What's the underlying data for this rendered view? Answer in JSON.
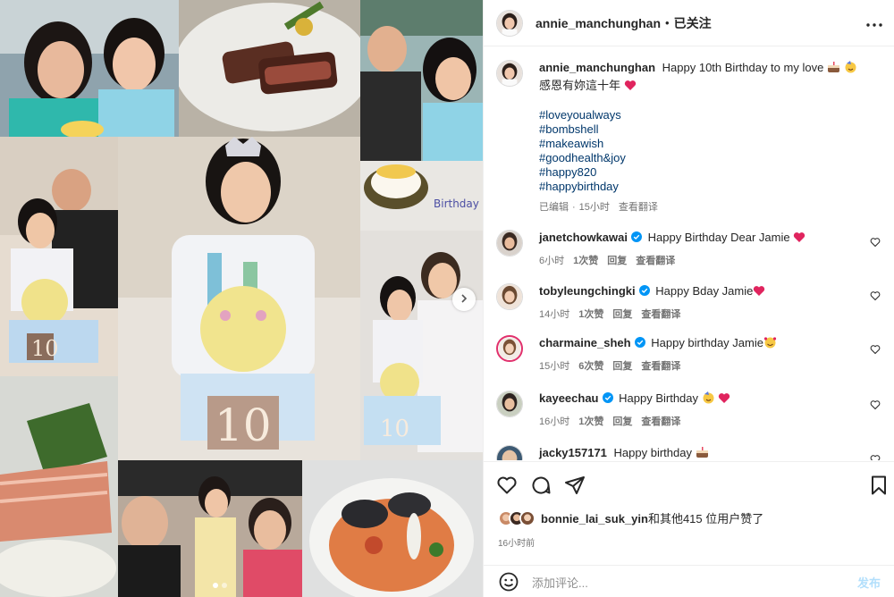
{
  "post": {
    "author": "annie_manchunghan",
    "separator": "•",
    "follow_status": "已关注",
    "caption": {
      "line1": "Happy 10th Birthday to my love",
      "line2": "感恩有妳這十年",
      "hashtags": [
        "#loveyoualways",
        "#bombshell",
        "#makeawish",
        "#goodhealth&joy",
        "#happy820",
        "#happybirthday"
      ],
      "edited": "已编辑",
      "dot": "·",
      "time": "15小时",
      "translate": "查看翻译"
    }
  },
  "comments": [
    {
      "user": "janetchowkawai",
      "verified": true,
      "text": "Happy Birthday Dear Jamie",
      "emoji_after": "heart",
      "time": "6小时",
      "likes": "1次赞",
      "reply": "回复",
      "translate": "查看翻译"
    },
    {
      "user": "tobyleungchingki",
      "verified": true,
      "text": "Happy Bday Jamie",
      "emoji_after": "heart",
      "time": "14小时",
      "likes": "1次赞",
      "reply": "回复",
      "translate": "查看翻译"
    },
    {
      "user": "charmaine_sheh",
      "verified": true,
      "text": "Happy birthday Jamie",
      "emoji_after": "hearts-face",
      "time": "15小时",
      "likes": "6次赞",
      "reply": "回复",
      "translate": "查看翻译"
    },
    {
      "user": "kayeechau",
      "verified": true,
      "text": "Happy Birthday",
      "emoji_after": "party-face-heart",
      "time": "16小时",
      "likes": "1次赞",
      "reply": "回复",
      "translate": "查看翻译"
    },
    {
      "user": "jacky157171",
      "verified": false,
      "text": "Happy birthday",
      "emoji_after": "cake",
      "time": "",
      "likes": "",
      "reply": "",
      "translate": ""
    }
  ],
  "likes": {
    "first_user": "bonnie_lai_suk_yin",
    "rest": "和其他415 位用户赞了"
  },
  "posted_time": "16小时前",
  "composer": {
    "placeholder": "添加评论...",
    "post_label": "发布"
  },
  "icons": {
    "more": "more-horizontal-icon",
    "like": "heart-outline-icon",
    "comment": "comment-bubble-icon",
    "share": "paper-plane-icon",
    "save": "bookmark-icon",
    "emoji": "emoji-smile-icon",
    "next": "chevron-right-icon"
  },
  "colors": {
    "link": "#00376b",
    "muted": "#737373",
    "verified": "#0095f6",
    "heart": "#ed4956",
    "post_disabled": "#b2dffc"
  }
}
